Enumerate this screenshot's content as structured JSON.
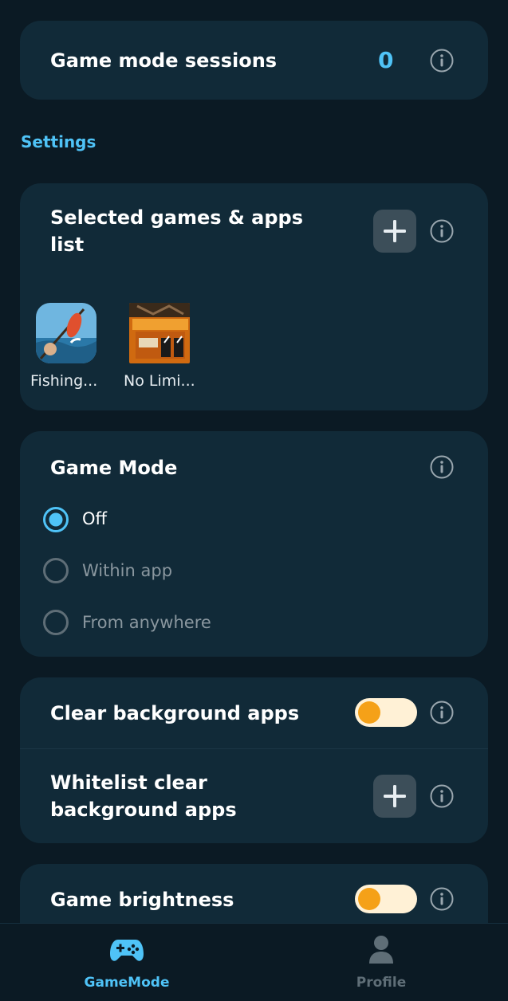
{
  "sessions": {
    "label": "Game mode sessions",
    "value": "0"
  },
  "settings_header": "Settings",
  "selected_apps": {
    "title_line1": "Selected games & apps",
    "title_line2": "list",
    "apps": [
      {
        "name": "Fishing...",
        "icon": "fishing-game-icon"
      },
      {
        "name": "No Limi...",
        "icon": "truck-game-icon"
      }
    ]
  },
  "game_mode": {
    "title": "Game Mode",
    "options": [
      {
        "label": "Off",
        "selected": true
      },
      {
        "label": "Within app",
        "selected": false
      },
      {
        "label": "From anywhere",
        "selected": false
      }
    ]
  },
  "clear_background": {
    "label": "Clear background apps",
    "enabled": true
  },
  "whitelist": {
    "line1": "Whitelist clear",
    "line2": "background apps"
  },
  "brightness": {
    "label": "Game brightness",
    "enabled": true
  },
  "nav": {
    "items": [
      {
        "label": "GameMode",
        "icon": "gamepad-icon",
        "active": true
      },
      {
        "label": "Profile",
        "icon": "person-icon",
        "active": false
      }
    ]
  },
  "colors": {
    "accent": "#4fc3f7",
    "card": "#112a38",
    "background": "#0b1a24",
    "toggle_knob": "#f5a118",
    "toggle_track": "#fff1d6"
  }
}
